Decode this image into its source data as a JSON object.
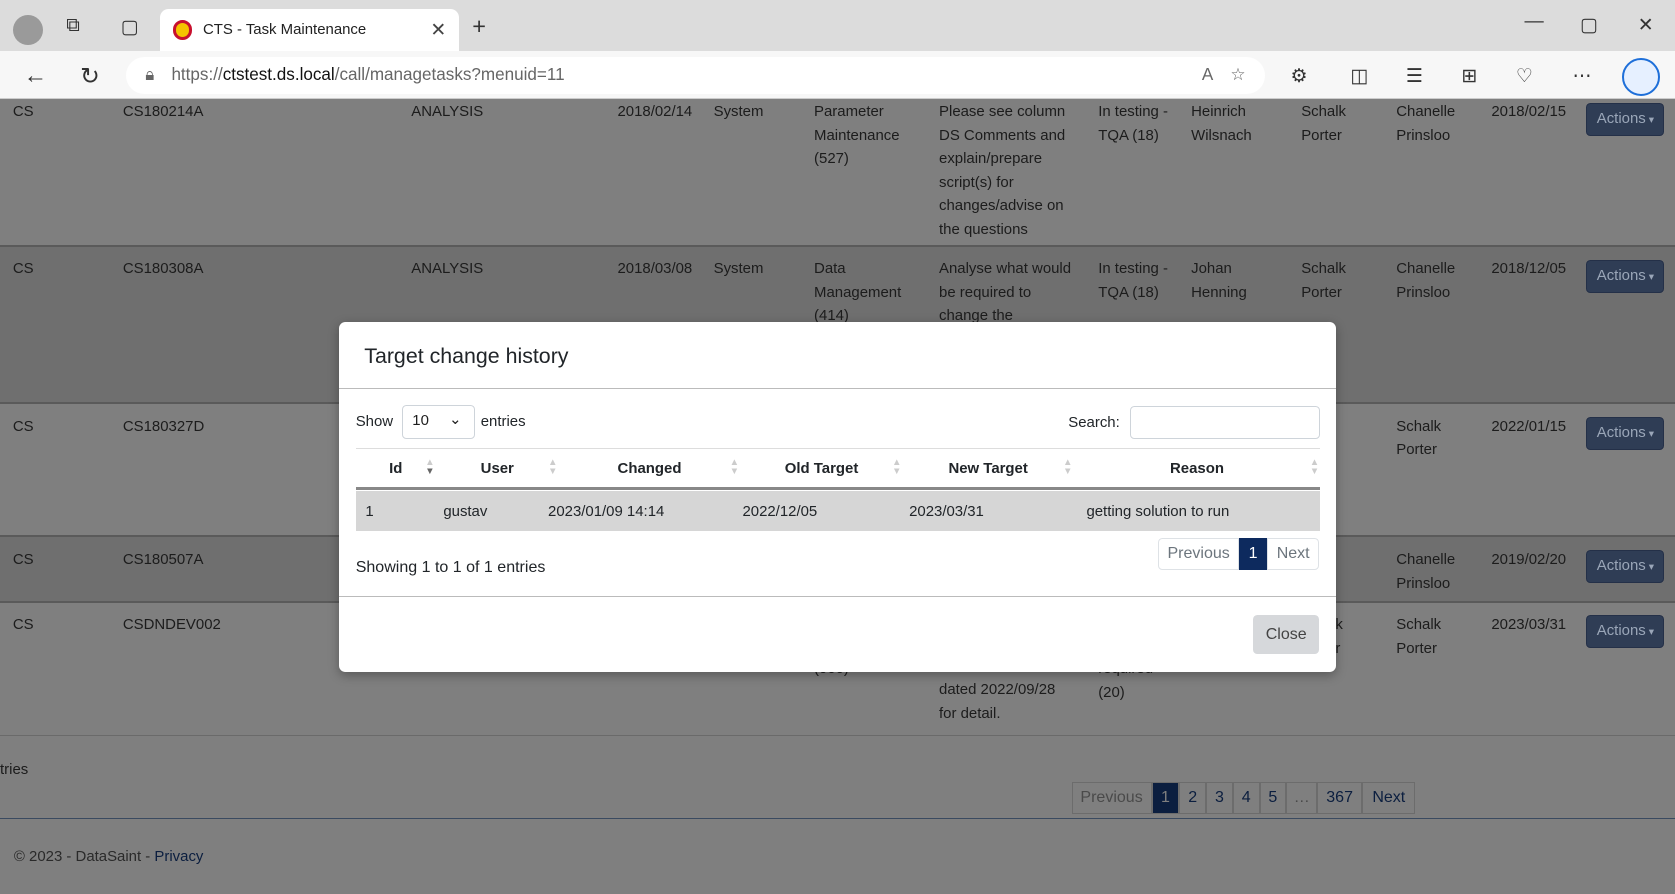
{
  "browser": {
    "tab_title": "CTS - Task Maintenance",
    "url_host": "ctstest.ds.local",
    "url_prefix": "https://",
    "url_path": "/call/managetasks?menuid=11"
  },
  "rows": [
    {
      "c0": "CS",
      "c1": "CS180214A",
      "c2": "ANALYSIS",
      "c3": "2018/02/14",
      "c4": "System",
      "c5": [
        "Parameter",
        "Maintenance",
        "(527)"
      ],
      "c6": [
        "Please see column",
        "DS Comments and",
        "explain/prepare",
        "script(s) for",
        "changes/advise on",
        "the questions"
      ],
      "c7": [
        "In testing -",
        "TQA (18)"
      ],
      "c8": [
        "Heinrich",
        "Wilsnach"
      ],
      "c9": [
        "Schalk",
        "Porter"
      ],
      "c10": [
        "Chanelle",
        "Prinsloo"
      ],
      "c11": "2018/02/15",
      "action": "Actions"
    },
    {
      "c0": "CS",
      "c1": "CS180308A",
      "c2": "ANALYSIS",
      "c3": "2018/03/08",
      "c4": "System",
      "c5": [
        "Data",
        "Management",
        "(414)"
      ],
      "c6": [
        "Analyse what would",
        "be required to",
        "change the"
      ],
      "c7": [
        "In testing -",
        "TQA (18)"
      ],
      "c8": [
        "Johan",
        "Henning"
      ],
      "c9": [
        "Schalk",
        "Porter"
      ],
      "c10": [
        "Chanelle",
        "Prinsloo"
      ],
      "c11": "2018/12/05",
      "action": "Actions"
    },
    {
      "c0": "CS",
      "c1": "CS180327D",
      "c9": [
        "r"
      ],
      "c10": [
        "Schalk",
        "Porter"
      ],
      "c11": "2022/01/15",
      "action": "Actions"
    },
    {
      "c0": "CS",
      "c1": "CS180507A",
      "c9": [
        "r"
      ],
      "c10": [
        "Chanelle",
        "Prinsloo"
      ],
      "c11": "2019/02/20",
      "action": "Actions"
    },
    {
      "c0": "CS",
      "c1": "CSDNDEV002",
      "c5": [
        "(000)"
      ],
      "c6": [
        "version - see email",
        "dated 2022/09/28",
        "for detail."
      ],
      "c7": [
        "required",
        "(20)"
      ],
      "c9": [
        "k",
        "r"
      ],
      "c10": [
        "Schalk",
        "Porter"
      ],
      "c11": "2023/03/31",
      "action": "Actions"
    }
  ],
  "page_info_fragment": "tries",
  "pagination": {
    "previous": "Previous",
    "pages": [
      "1",
      "2",
      "3",
      "4",
      "5"
    ],
    "ellipsis": "…",
    "last": "367",
    "next": "Next",
    "active": "1"
  },
  "footer": {
    "copyright": "© 2023 - DataSaint - ",
    "privacy": "Privacy"
  },
  "modal": {
    "title": "Target change history",
    "show_label": "Show",
    "entries_value": "10",
    "entries_label": "entries",
    "search_label": "Search:",
    "search_value": "",
    "columns": [
      "Id",
      "User",
      "Changed",
      "Old Target",
      "New Target",
      "Reason"
    ],
    "rows": [
      [
        "1",
        "gustav",
        "2023/01/09 14:14",
        "2022/12/05",
        "2023/03/31",
        "getting solution to run"
      ]
    ],
    "info": "Showing 1 to 1 of 1 entries",
    "pagination": {
      "previous": "Previous",
      "page": "1",
      "next": "Next"
    },
    "close": "Close"
  },
  "colors": {
    "active_page": "#0d2a5e",
    "actions_button": "#2f3d55"
  }
}
